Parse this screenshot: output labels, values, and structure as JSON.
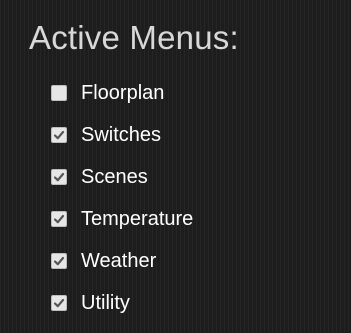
{
  "panel": {
    "title": "Active Menus:"
  },
  "menus": [
    {
      "label": "Floorplan",
      "checked": false
    },
    {
      "label": "Switches",
      "checked": true
    },
    {
      "label": "Scenes",
      "checked": true
    },
    {
      "label": "Temperature",
      "checked": true
    },
    {
      "label": "Weather",
      "checked": true
    },
    {
      "label": "Utility",
      "checked": true
    }
  ],
  "icons": {
    "checked": "checkmark-icon"
  },
  "colors": {
    "background": "#1d1d1d",
    "title": "#d8d8d8",
    "label": "#ffffff",
    "checkbox_fill": "#e6e6e6",
    "checkmark": "#555555"
  }
}
